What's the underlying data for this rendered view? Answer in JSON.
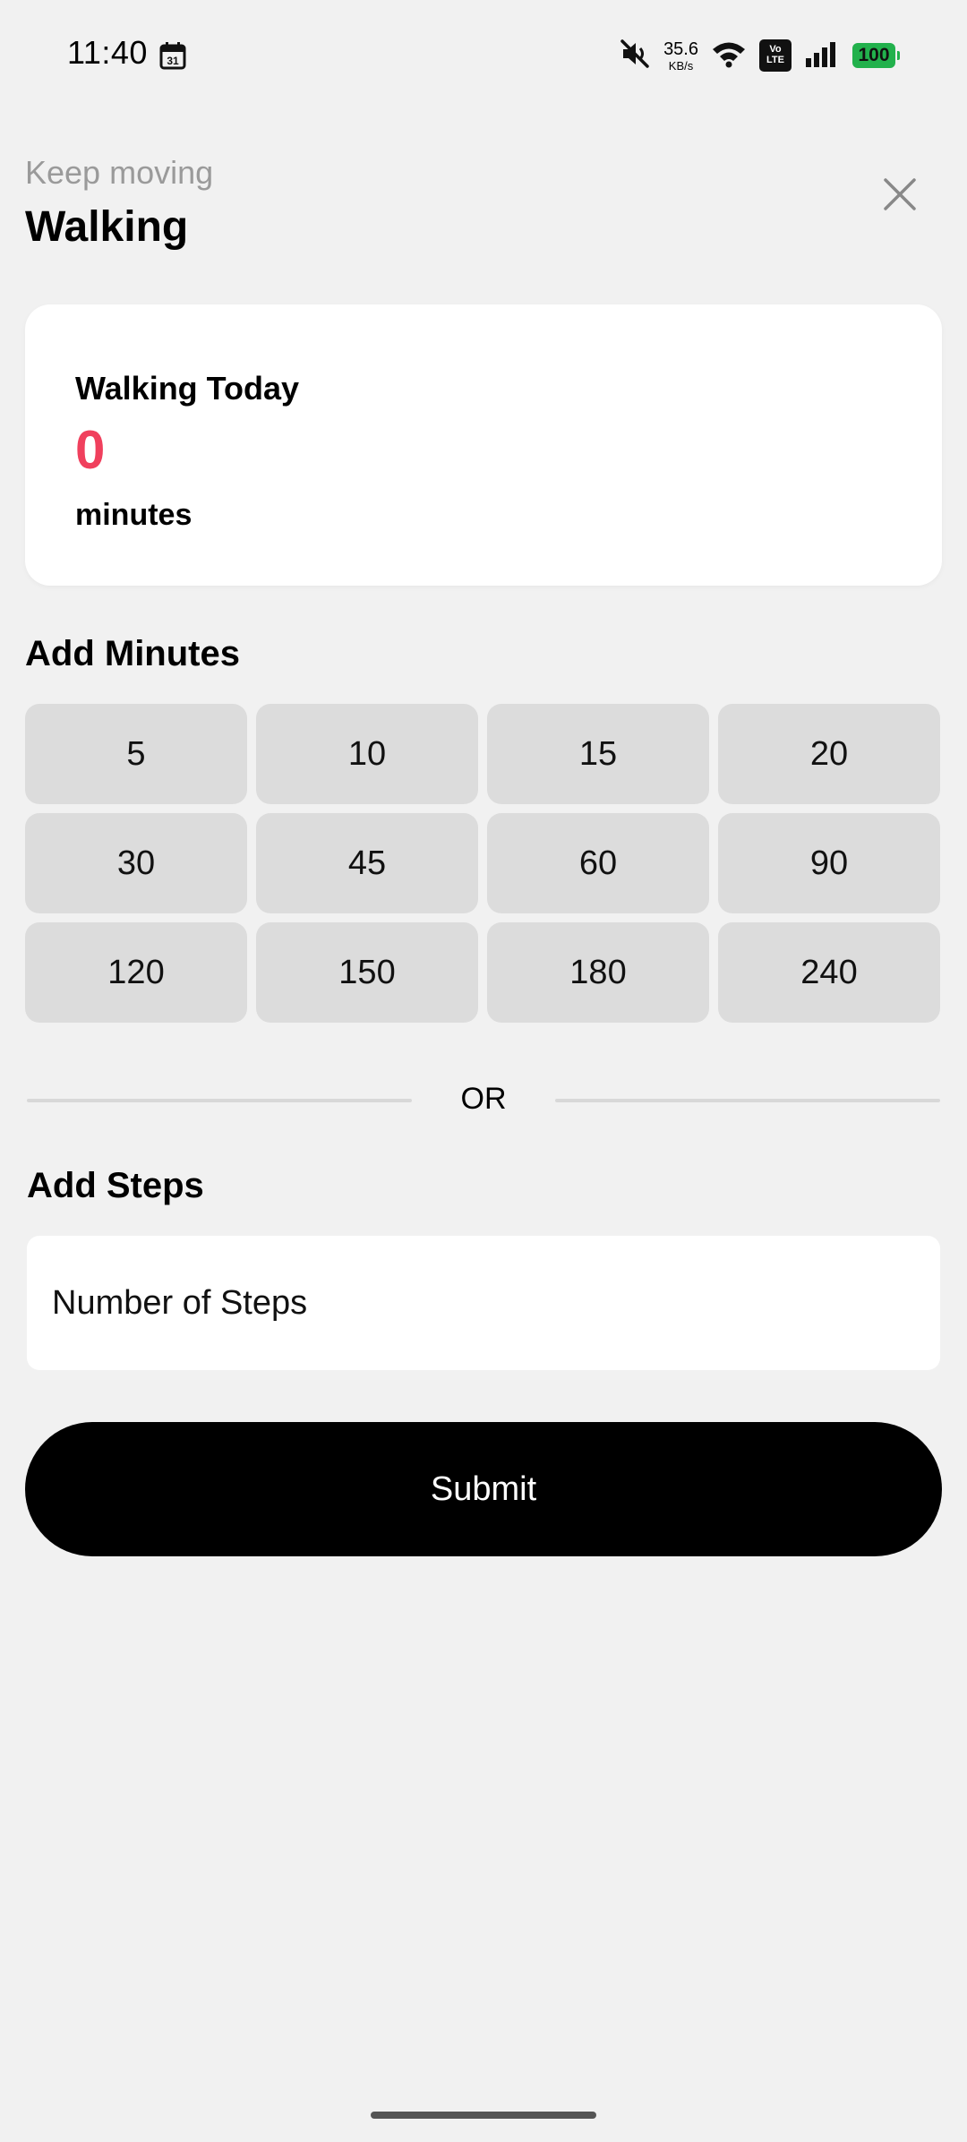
{
  "status_bar": {
    "time": "11:40",
    "calendar_day": "31",
    "net_speed_value": "35.6",
    "net_speed_unit": "KB/s",
    "volte_top": "Vo",
    "volte_bottom": "LTE",
    "battery": "100",
    "battery_color": "#22b14c"
  },
  "header": {
    "subtitle": "Keep moving",
    "title": "Walking",
    "close_icon": "close-icon"
  },
  "today_card": {
    "title": "Walking Today",
    "value": "0",
    "unit": "minutes",
    "value_color": "#f0405d"
  },
  "add_minutes": {
    "heading": "Add Minutes",
    "options": [
      "5",
      "10",
      "15",
      "20",
      "30",
      "45",
      "60",
      "90",
      "120",
      "150",
      "180",
      "240"
    ]
  },
  "divider": {
    "label": "OR"
  },
  "add_steps": {
    "heading": "Add Steps",
    "placeholder": "Number of Steps",
    "value": ""
  },
  "submit": {
    "label": "Submit"
  }
}
